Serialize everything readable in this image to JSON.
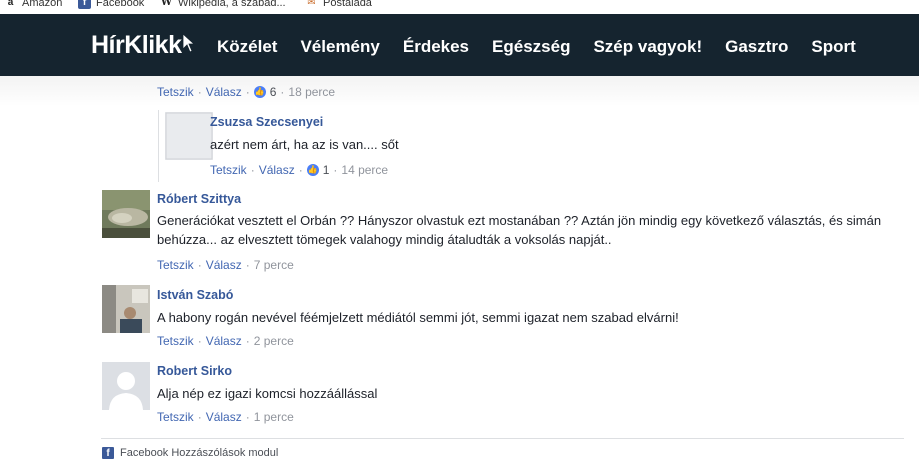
{
  "bookmarks": [
    {
      "label": "Amazon",
      "icon": "amazon-icon"
    },
    {
      "label": "Facebook",
      "icon": "facebook-icon"
    },
    {
      "label": "Wikipedia, a szabad...",
      "icon": "wikipedia-icon"
    },
    {
      "label": "Postaláda",
      "icon": "postal-icon"
    }
  ],
  "site": {
    "logo": "HírKlikk",
    "nav": [
      "Közélet",
      "Vélemény",
      "Érdekes",
      "Egészség",
      "Szép vagyok!",
      "Gasztro",
      "Sport"
    ]
  },
  "actions": {
    "like": "Tetszik",
    "reply": "Válasz",
    "sep": "·"
  },
  "comments": {
    "top_meta": {
      "likes": "6",
      "time": "18 perce"
    },
    "c1": {
      "author": "Zsuzsa Szecsenyei",
      "text": "azért nem árt, ha az is van.... sőt",
      "likes": "1",
      "time": "14 perce"
    },
    "c2": {
      "author": "Róbert Szittya",
      "text": "Generációkat vesztett el Orbán ?? Hányszor olvastuk ezt mostanában ?? Aztán jön mindig egy következő választás, és simán behúzza... az elvesztett tömegek valahogy mindig átaludták a voksolás napját..",
      "time": "7 perce"
    },
    "c3": {
      "author": "István Szabó",
      "text": "A habony rogán nevével féémjelzett médiától semmi jót, semmi igazat nem szabad elvárni!",
      "time": "2 perce"
    },
    "c4": {
      "author": "Robert Sirko",
      "text": "Alja nép ez igazi komcsi hozzáállással",
      "time": "1 perce"
    }
  },
  "footer": {
    "plugin": "Facebook Hozzászólások modul"
  },
  "colors": {
    "navbar": "#15242f",
    "link": "#4267b2",
    "author": "#365899",
    "like_badge": "#4a7ef7"
  }
}
